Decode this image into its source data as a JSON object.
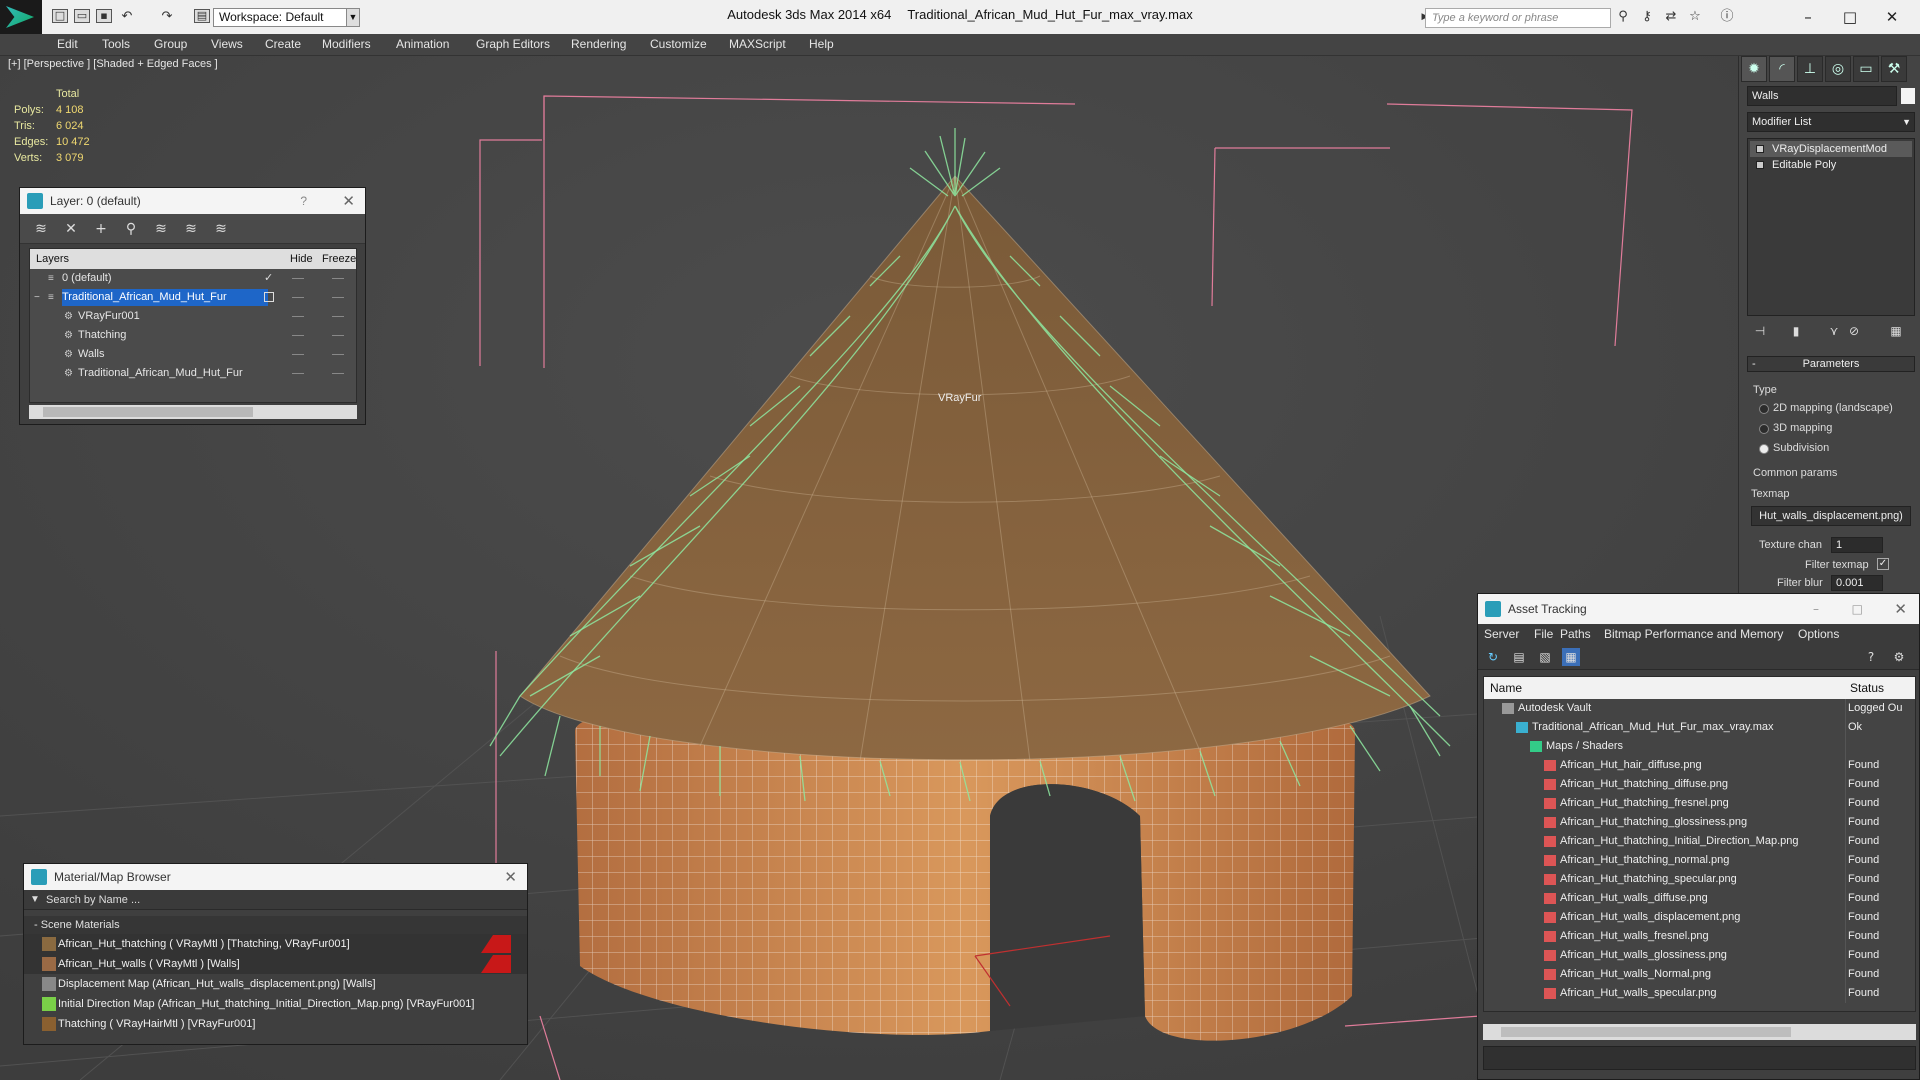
{
  "app": {
    "title": "Autodesk 3ds Max  2014 x64",
    "file": "Traditional_African_Mud_Hut_Fur_max_vray.max",
    "workspace": "Workspace: Default",
    "search_placeholder": "Type a keyword or phrase"
  },
  "menu": [
    "Edit",
    "Tools",
    "Group",
    "Views",
    "Create",
    "Modifiers",
    "Animation",
    "Graph Editors",
    "Rendering",
    "Customize",
    "MAXScript",
    "Help"
  ],
  "viewport": {
    "label": "[+] [Perspective ] [Shaded + Edged Faces ]",
    "object_label": "VRayFur",
    "stats": {
      "header": "Total",
      "rows": [
        {
          "label": "Polys:",
          "value": "4 108"
        },
        {
          "label": "Tris:",
          "value": "6 024"
        },
        {
          "label": "Edges:",
          "value": "10 472"
        },
        {
          "label": "Verts:",
          "value": "3 079"
        }
      ]
    }
  },
  "layer_window": {
    "title": "Layer: 0 (default)",
    "help": "?",
    "columns": {
      "layers": "Layers",
      "hide": "Hide",
      "freeze": "Freeze"
    },
    "rows": [
      {
        "name": "0 (default)",
        "indent": 0,
        "selected": false
      },
      {
        "name": "Traditional_African_Mud_Hut_Fur",
        "indent": 0,
        "selected": true
      },
      {
        "name": "VRayFur001",
        "indent": 1,
        "selected": false
      },
      {
        "name": "Thatching",
        "indent": 1,
        "selected": false
      },
      {
        "name": "Walls",
        "indent": 1,
        "selected": false
      },
      {
        "name": "Traditional_African_Mud_Hut_Fur",
        "indent": 1,
        "selected": false
      }
    ]
  },
  "material_browser": {
    "title": "Material/Map Browser",
    "search_placeholder": "Search by Name ...",
    "group": "- Scene Materials",
    "rows": [
      {
        "label": "African_Hut_thatching  ( VRayMtl ) [Thatching, VRayFur001]",
        "swatch": "#8a6a40",
        "flag": true
      },
      {
        "label": "African_Hut_walls  ( VRayMtl ) [Walls]",
        "swatch": "#9a6a45",
        "flag": true
      },
      {
        "label": "Displacement Map (African_Hut_walls_displacement.png) [Walls]",
        "swatch": "#888888",
        "flag": false
      },
      {
        "label": "Initial Direction Map (African_Hut_thatching_Initial_Direction_Map.png) [VRayFur001]",
        "swatch": "#7ad048",
        "flag": false
      },
      {
        "label": "Thatching  ( VRayHairMtl ) [VRayFur001]",
        "swatch": "#8a6030",
        "flag": false
      }
    ]
  },
  "command_panel": {
    "object_name": "Walls",
    "modifier_list": "Modifier List",
    "stack": [
      "VRayDisplacementMod",
      "Editable Poly"
    ],
    "parameters_title": "Parameters",
    "type_label": "Type",
    "type_options": [
      {
        "label": "2D mapping (landscape)",
        "on": false
      },
      {
        "label": "3D mapping",
        "on": false
      },
      {
        "label": "Subdivision",
        "on": true
      }
    ],
    "common_params": "Common params",
    "texmap_label": "Texmap",
    "texmap_value": "Hut_walls_displacement.png)",
    "texture_chan_label": "Texture chan",
    "texture_chan_value": "1",
    "filter_texmap_label": "Filter texmap",
    "filter_blur_label": "Filter blur",
    "filter_blur_value": "0.001"
  },
  "asset_tracking": {
    "title": "Asset Tracking",
    "menu": [
      "Server",
      "File",
      "Paths",
      "Bitmap Performance and Memory",
      "Options"
    ],
    "columns": {
      "name": "Name",
      "status": "Status"
    },
    "rows": [
      {
        "name": "Autodesk Vault",
        "status": "Logged Ou",
        "indent": 0,
        "icon": "vault"
      },
      {
        "name": "Traditional_African_Mud_Hut_Fur_max_vray.max",
        "status": "Ok",
        "indent": 1,
        "icon": "max"
      },
      {
        "name": "Maps / Shaders",
        "status": "",
        "indent": 2,
        "icon": "folder"
      },
      {
        "name": "African_Hut_hair_diffuse.png",
        "status": "Found",
        "indent": 3,
        "icon": "png"
      },
      {
        "name": "African_Hut_thatching_diffuse.png",
        "status": "Found",
        "indent": 3,
        "icon": "png"
      },
      {
        "name": "African_Hut_thatching_fresnel.png",
        "status": "Found",
        "indent": 3,
        "icon": "png"
      },
      {
        "name": "African_Hut_thatching_glossiness.png",
        "status": "Found",
        "indent": 3,
        "icon": "png"
      },
      {
        "name": "African_Hut_thatching_Initial_Direction_Map.png",
        "status": "Found",
        "indent": 3,
        "icon": "png"
      },
      {
        "name": "African_Hut_thatching_normal.png",
        "status": "Found",
        "indent": 3,
        "icon": "png"
      },
      {
        "name": "African_Hut_thatching_specular.png",
        "status": "Found",
        "indent": 3,
        "icon": "png"
      },
      {
        "name": "African_Hut_walls_diffuse.png",
        "status": "Found",
        "indent": 3,
        "icon": "png"
      },
      {
        "name": "African_Hut_walls_displacement.png",
        "status": "Found",
        "indent": 3,
        "icon": "png"
      },
      {
        "name": "African_Hut_walls_fresnel.png",
        "status": "Found",
        "indent": 3,
        "icon": "png"
      },
      {
        "name": "African_Hut_walls_glossiness.png",
        "status": "Found",
        "indent": 3,
        "icon": "png"
      },
      {
        "name": "African_Hut_walls_Normal.png",
        "status": "Found",
        "indent": 3,
        "icon": "png"
      },
      {
        "name": "African_Hut_walls_specular.png",
        "status": "Found",
        "indent": 3,
        "icon": "png"
      }
    ]
  }
}
